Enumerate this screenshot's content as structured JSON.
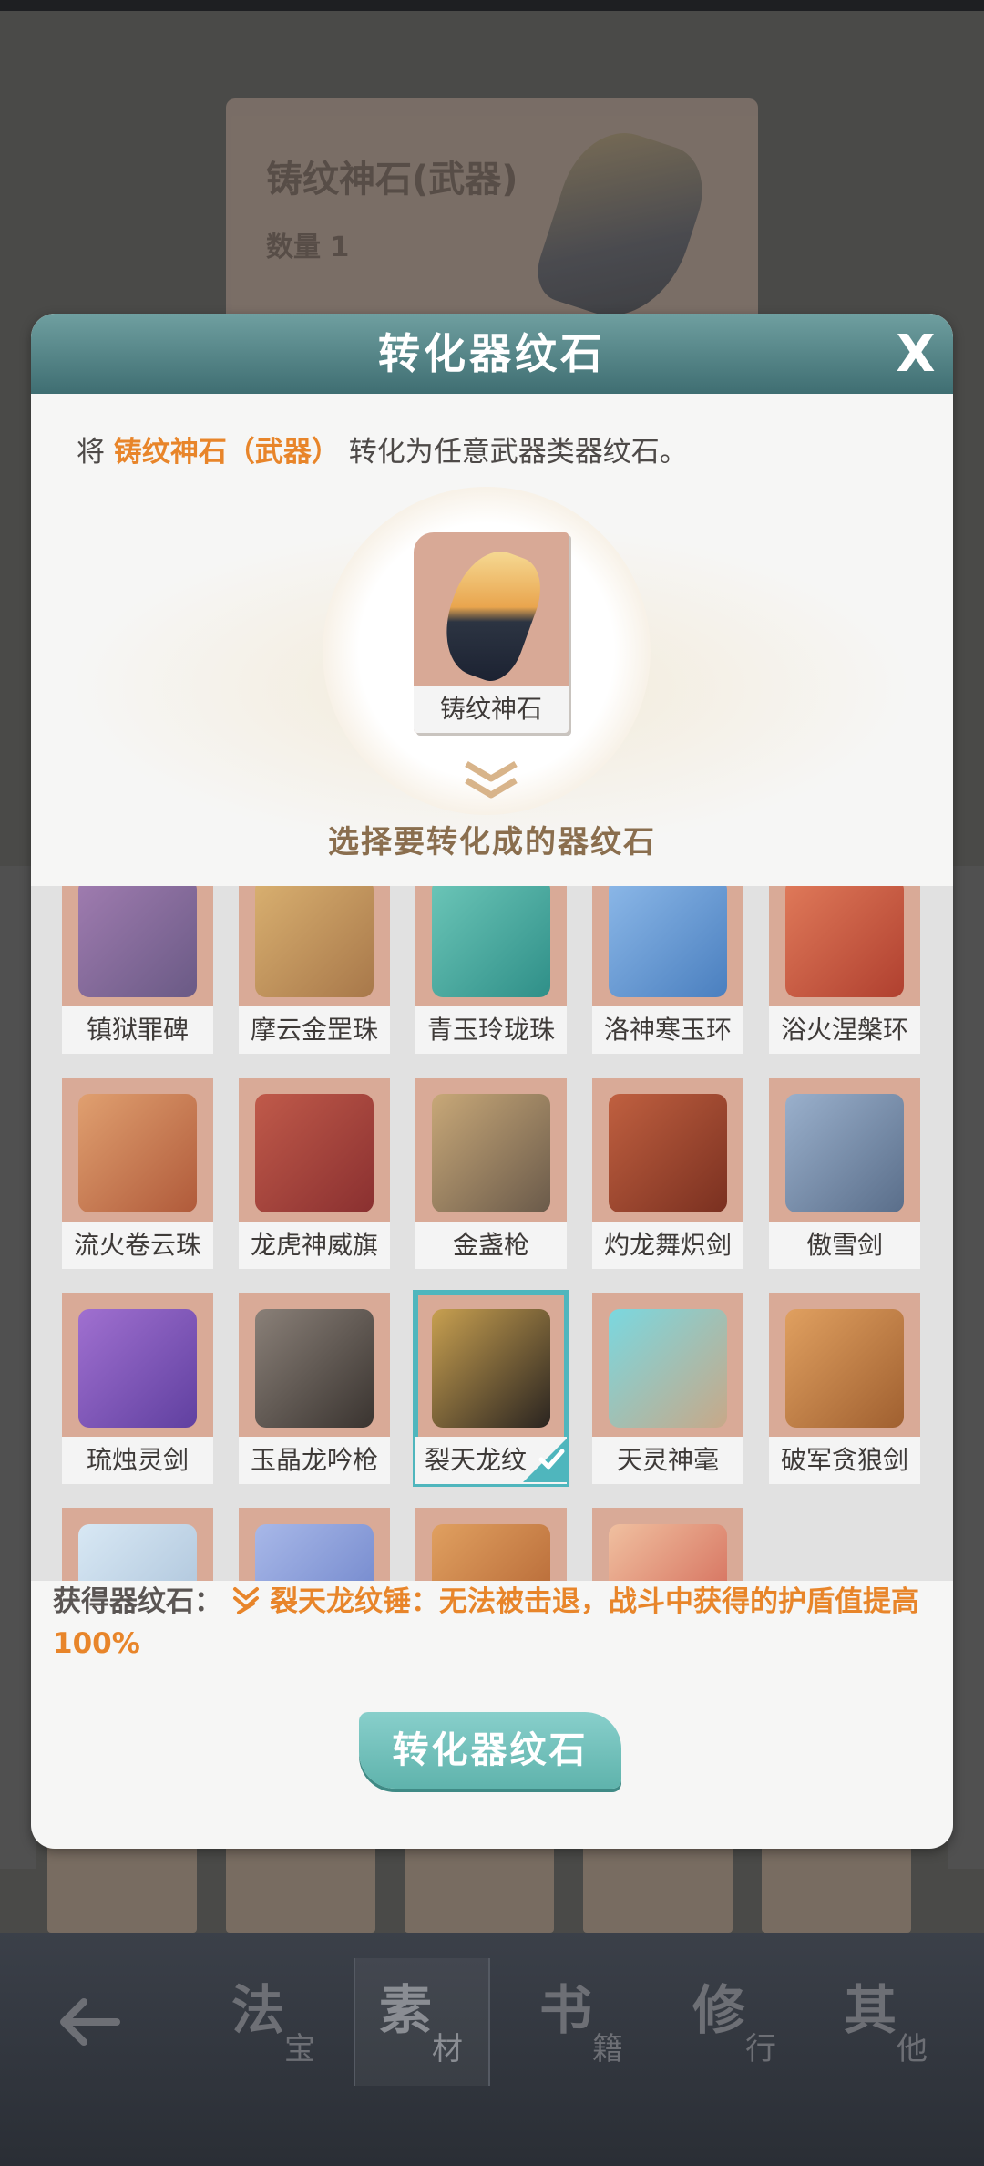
{
  "background": {
    "card_title": "铸纹神石(武器)",
    "card_count": "数量 1"
  },
  "modal": {
    "title": "转化器纹石",
    "close": "X",
    "description": {
      "prefix": "将 ",
      "item": "铸纹神石（武器）",
      "suffix": " 转化为任意武器类器纹石。"
    },
    "source_item": {
      "label": "铸纹神石"
    },
    "select_title": "选择要转化成的器纹石",
    "items": [
      {
        "name": "镇狱罪碑",
        "colors": [
          "#a07cb0",
          "#6a5a85"
        ]
      },
      {
        "name": "摩云金罡珠",
        "colors": [
          "#d9b070",
          "#a8784a"
        ]
      },
      {
        "name": "青玉玲珑珠",
        "colors": [
          "#6cc6b8",
          "#2f8f88"
        ]
      },
      {
        "name": "洛神寒玉环",
        "colors": [
          "#8cb8e8",
          "#4a7fbf"
        ]
      },
      {
        "name": "浴火涅槃环",
        "colors": [
          "#e07a5a",
          "#b0402f"
        ]
      },
      {
        "name": "流火卷云珠",
        "colors": [
          "#e0a070",
          "#b05a3a"
        ]
      },
      {
        "name": "龙虎神威旗",
        "colors": [
          "#c05a4a",
          "#8a3030"
        ]
      },
      {
        "name": "金盏枪",
        "colors": [
          "#c8a878",
          "#6a5a4a"
        ]
      },
      {
        "name": "灼龙舞炽剑",
        "colors": [
          "#c06040",
          "#7a3020"
        ]
      },
      {
        "name": "傲雪剑",
        "colors": [
          "#9ab0cc",
          "#5a6e8a"
        ]
      },
      {
        "name": "琉烛灵剑",
        "colors": [
          "#a070d0",
          "#6040a0"
        ]
      },
      {
        "name": "玉晶龙吟枪",
        "colors": [
          "#8a8078",
          "#3a3430"
        ]
      },
      {
        "name": "裂天龙纹锤",
        "colors": [
          "#c8a050",
          "#2a2420"
        ]
      },
      {
        "name": "天灵神毫",
        "colors": [
          "#7ad8e0",
          "#c8a888"
        ]
      },
      {
        "name": "破军贪狼剑",
        "colors": [
          "#e0a060",
          "#a06030"
        ]
      },
      {
        "name": "",
        "colors": [
          "#d8e8f4",
          "#a8c0d8"
        ]
      },
      {
        "name": "",
        "colors": [
          "#a8b8e8",
          "#6a80c8"
        ]
      },
      {
        "name": "",
        "colors": [
          "#e0a060",
          "#b06030"
        ]
      },
      {
        "name": "",
        "colors": [
          "#f0c0a0",
          "#d06050"
        ]
      }
    ],
    "selected_index": 12,
    "selected_display_name": "裂天龙纹",
    "result": {
      "label": "获得器纹石：",
      "text": "裂天龙纹锤：无法被击退，战斗中获得的护盾值提高100%"
    },
    "confirm_button": "转化器纹石"
  },
  "bottom_nav": {
    "tabs": [
      {
        "big": "法",
        "small": "宝"
      },
      {
        "big": "素",
        "small": "材"
      },
      {
        "big": "书",
        "small": "籍"
      },
      {
        "big": "修",
        "small": "行"
      },
      {
        "big": "其",
        "small": "他"
      }
    ],
    "active_index": 1
  },
  "colors": {
    "accent_teal": "#4fb6bd",
    "highlight_orange": "#e8852a",
    "header_teal": "#3f6e72"
  }
}
